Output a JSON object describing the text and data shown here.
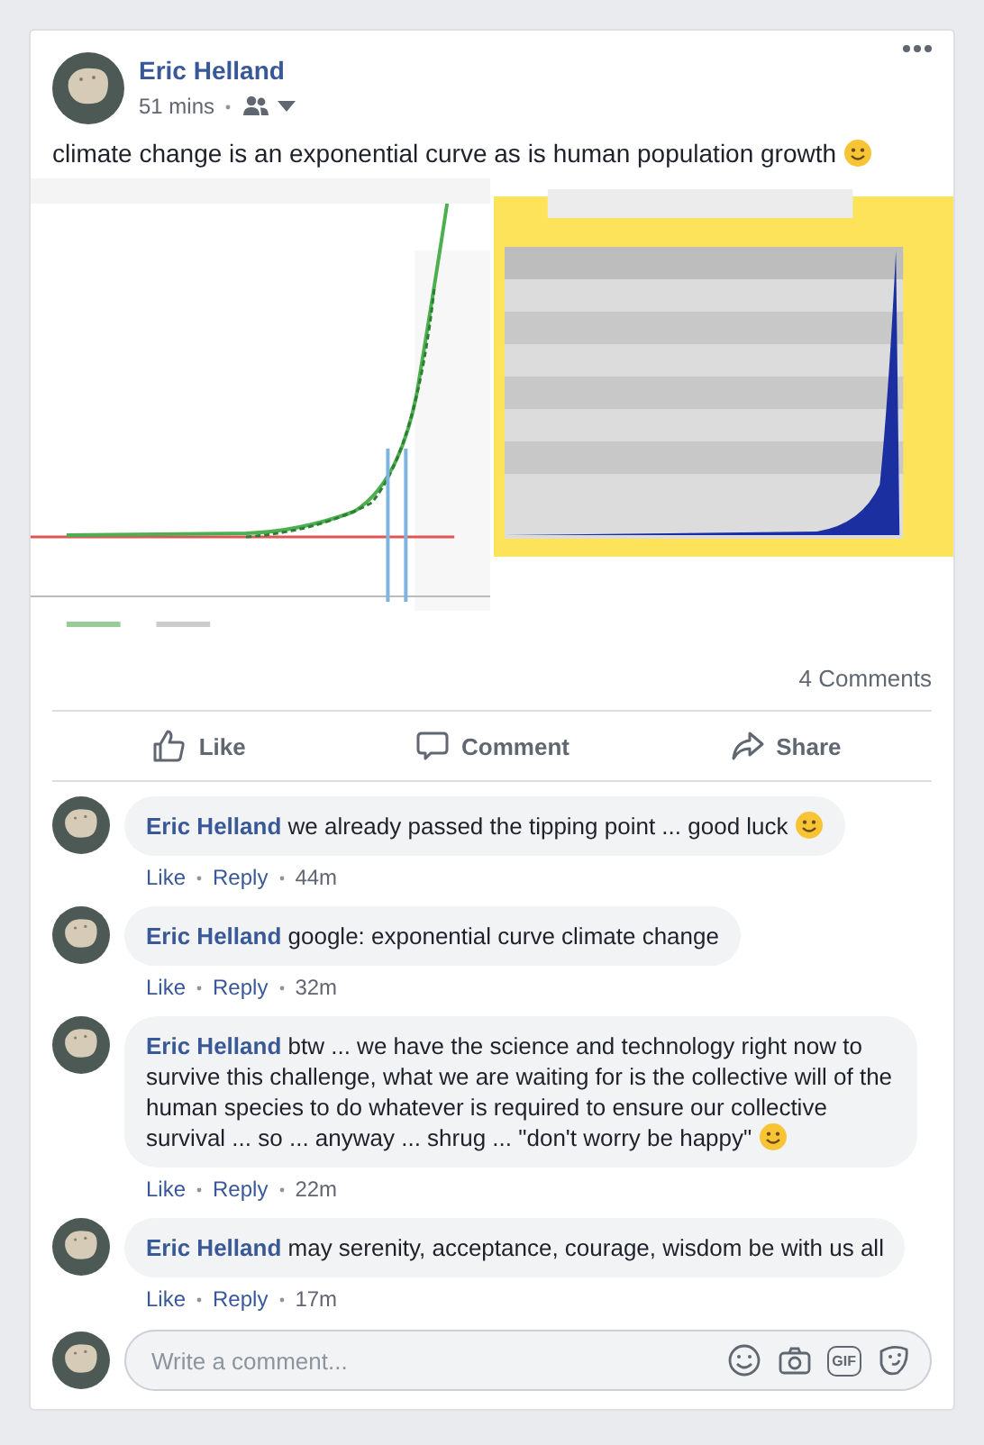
{
  "post": {
    "author": "Eric Helland",
    "time": "51 mins",
    "text": "climate change is an exponential curve as is human population growth",
    "smiley": true,
    "comment_count": "4 Comments",
    "actions": [
      {
        "kind": "like",
        "label": "Like"
      },
      {
        "kind": "comment",
        "label": "Comment"
      },
      {
        "kind": "share",
        "label": "Share"
      }
    ]
  },
  "comments": [
    {
      "author": "Eric Helland",
      "text": "we already passed the tipping point ... good luck",
      "smiley": true,
      "like": "Like",
      "reply": "Reply",
      "time": "44m"
    },
    {
      "author": "Eric Helland",
      "text": "google: exponential curve climate change",
      "smiley": false,
      "like": "Like",
      "reply": "Reply",
      "time": "32m"
    },
    {
      "author": "Eric Helland",
      "text": "btw ... we have the science and technology right now to survive this challenge, what we are waiting for is the collective will of the human species to do whatever is required to ensure our collective survival ... so ... anyway ... shrug ... \"don't worry be happy\"",
      "smiley": true,
      "like": "Like",
      "reply": "Reply",
      "time": "22m"
    },
    {
      "author": "Eric Helland",
      "text": "may serenity, acceptance, courage, wisdom be with us all",
      "smiley": false,
      "like": "Like",
      "reply": "Reply",
      "time": "17m"
    }
  ],
  "composer": {
    "placeholder": "Write a comment...",
    "tools": [
      {
        "kind": "smiley"
      },
      {
        "kind": "camera"
      },
      {
        "kind": "gif",
        "label": "GIF"
      },
      {
        "kind": "sticker"
      }
    ]
  }
}
